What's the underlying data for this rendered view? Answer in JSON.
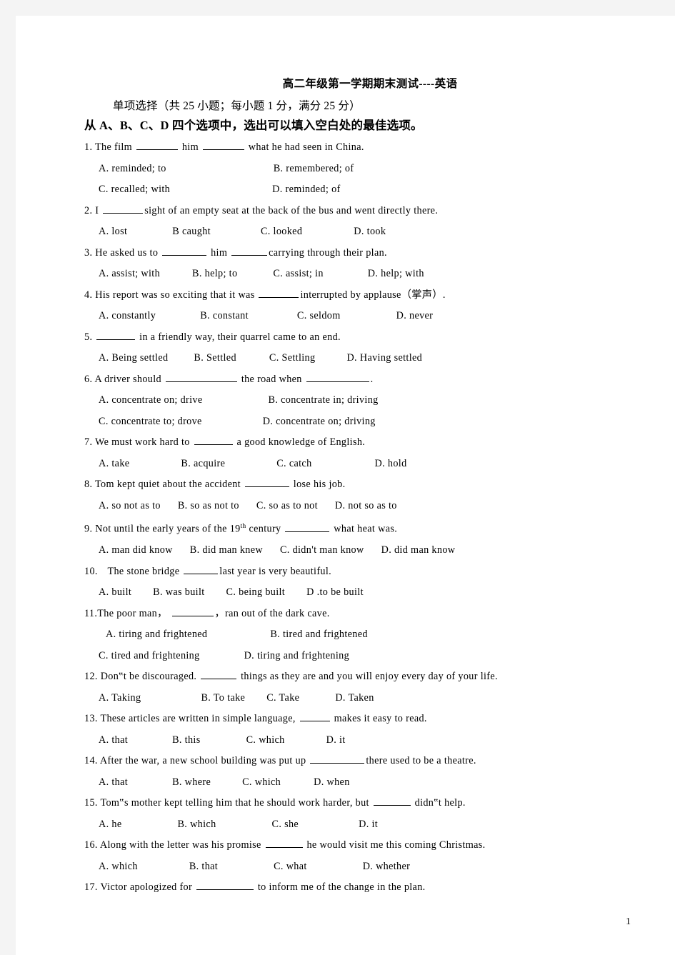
{
  "document": {
    "title": "高二年级第一学期期末测试----英语",
    "subtitle": "单项选择（共 25 小题；每小题 1 分，满分 25 分）",
    "instruction": "从 A、B、C、D 四个选项中，选出可以填入空白处的最佳选项。",
    "page_number": "1"
  },
  "questions": [
    {
      "number": "1.",
      "stem_a": "The film",
      "stem_b": "him",
      "stem_c": "what he had seen in China.",
      "options": [
        "A. reminded; to",
        "B. remembered; of",
        "C. recalled; with",
        "D. reminded; of"
      ]
    },
    {
      "number": "2.",
      "stem_a": "I",
      "stem_b": "sight of an empty seat at the back of the bus and went directly there.",
      "options": [
        "A. lost",
        "B caught",
        "C. looked",
        "D. took"
      ]
    },
    {
      "number": "3.",
      "stem_a": "He asked us to",
      "stem_b": "him",
      "stem_c": "carrying through their plan.",
      "options": [
        "A. assist; with",
        "B. help; to",
        "C. assist; in",
        "D. help; with"
      ]
    },
    {
      "number": "4.",
      "stem_a": "His report was so exciting that it was",
      "stem_b": "interrupted by applause（掌声）.",
      "options": [
        "A. constantly",
        "B. constant",
        "C. seldom",
        "D. never"
      ]
    },
    {
      "number": "5.",
      "stem_a": "",
      "stem_b": "in a friendly way, their quarrel came to an end.",
      "options": [
        "A. Being settled",
        "B. Settled",
        "C. Settling",
        "D. Having settled"
      ]
    },
    {
      "number": "6.",
      "stem_a": "A driver should",
      "stem_b": "the road when",
      "stem_c": ".",
      "options": [
        "A. concentrate on; drive",
        "B. concentrate in; driving",
        "C. concentrate to; drove",
        "D. concentrate on; driving"
      ]
    },
    {
      "number": "7.",
      "stem_a": "We must work hard to",
      "stem_b": "a good knowledge of English.",
      "options": [
        "A. take",
        "B. acquire",
        "C. catch",
        "D. hold"
      ]
    },
    {
      "number": "8.",
      "stem_a": "Tom kept quiet about the accident",
      "stem_b": "lose his job.",
      "options": [
        "A. so not as to",
        "B. so as not to",
        "C. so as to not",
        "D. not so as to"
      ]
    },
    {
      "number": "9.",
      "stem_a": "Not until the early years of the 19",
      "stem_sup": "th",
      "stem_b": "century",
      "stem_c": "what heat was.",
      "options": [
        "A. man did know",
        "B. did man knew",
        "C. didn't man know",
        "D. did man know"
      ]
    },
    {
      "number": "10.",
      "stem_a": "The stone bridge",
      "stem_b": "last year is very beautiful.",
      "options": [
        "A. built",
        "B. was built",
        "C. being built",
        "D .to be built"
      ]
    },
    {
      "number": "11.",
      "stem_a": "The poor man，",
      "stem_b": "，ran out of the dark cave.",
      "options": [
        "A. tiring and frightened",
        "B. tired and frightened",
        "C. tired and frightening",
        "D. tiring and frightening"
      ]
    },
    {
      "number": "12.",
      "stem_a": "Don‟t be discouraged.",
      "stem_b": "things as they are and you will enjoy every day of your life.",
      "options": [
        "A. Taking",
        "B. To take",
        "C. Take",
        "D. Taken"
      ]
    },
    {
      "number": "13.",
      "stem_a": "These articles are written in simple language,",
      "stem_b": "makes it easy to read.",
      "options": [
        "A. that",
        "B. this",
        "C. which",
        "D. it"
      ]
    },
    {
      "number": "14.",
      "stem_a": "After the war, a new school building was put up",
      "stem_b": "there used to be a theatre.",
      "options": [
        "A. that",
        "B. where",
        "C. which",
        "D. when"
      ]
    },
    {
      "number": "15.",
      "stem_a": "Tom‟s mother kept telling him that he should work harder, but",
      "stem_b": "didn‟t help.",
      "options": [
        "A. he",
        "B. which",
        "C. she",
        "D. it"
      ]
    },
    {
      "number": "16.",
      "stem_a": "Along with the letter was his promise",
      "stem_b": "he would visit me this coming Christmas.",
      "options": [
        "A. which",
        "B. that",
        "C. what",
        "D. whether"
      ]
    },
    {
      "number": "17.",
      "stem_a": "Victor apologized for",
      "stem_b": "to inform me of the change in the plan.",
      "options": []
    }
  ]
}
